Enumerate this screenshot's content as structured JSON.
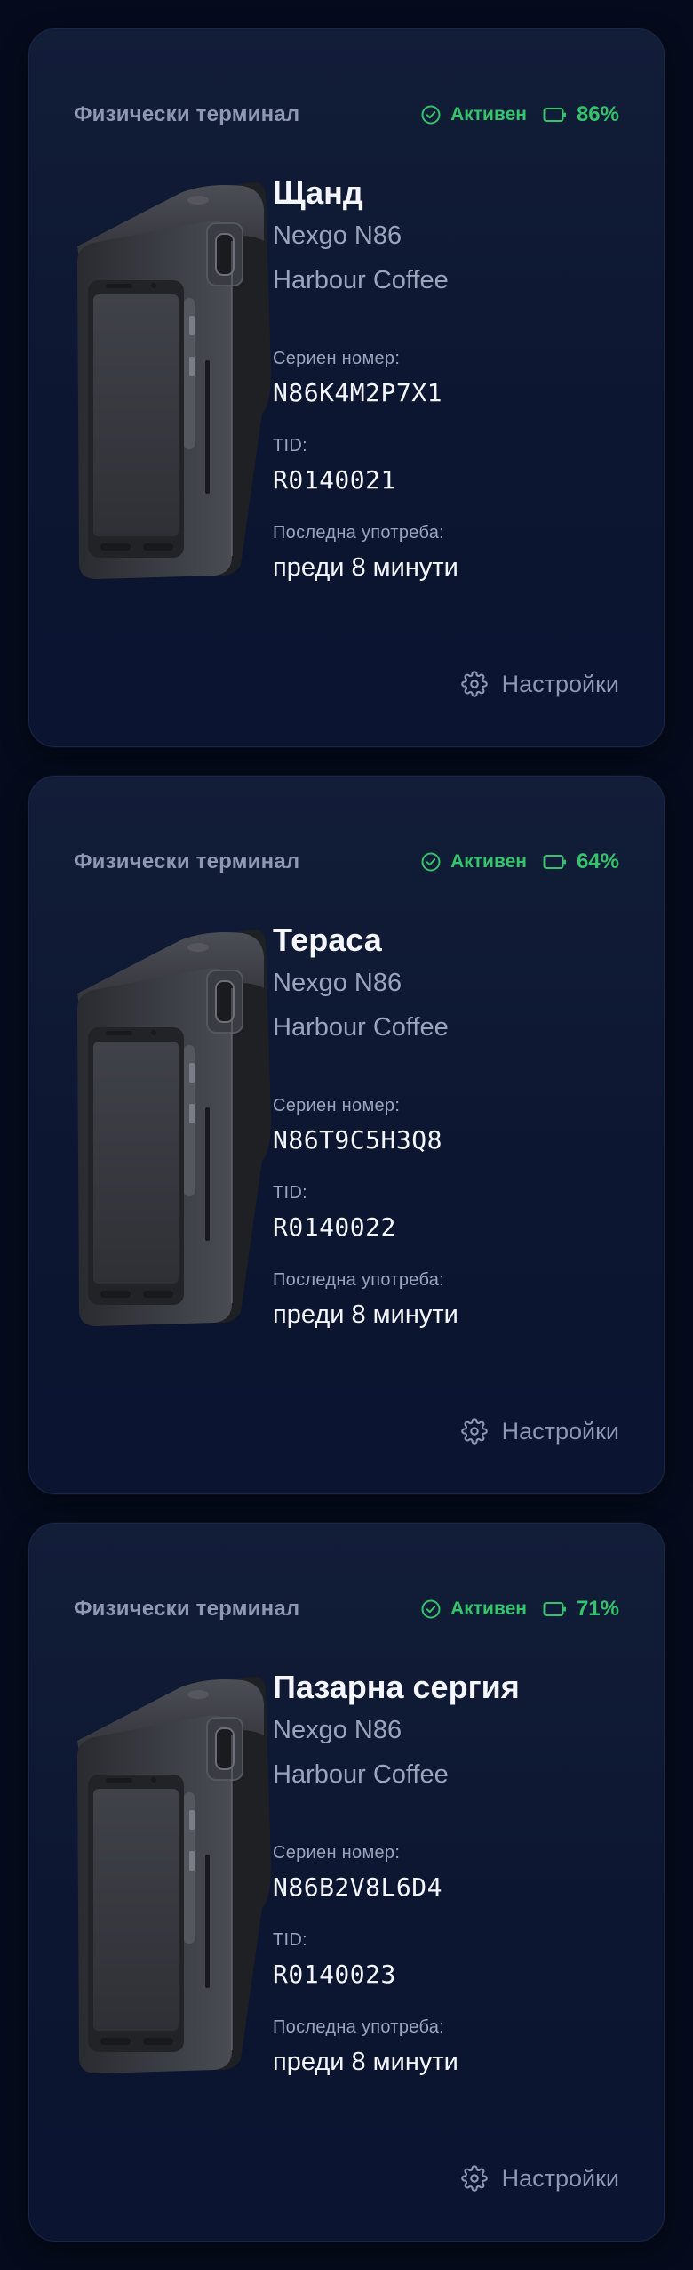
{
  "colors": {
    "background": "#050b1c",
    "card": "#0f1a36",
    "status_green": "#35c46b",
    "muted_text": "#8e98b2",
    "primary_text": "#f4f6fb"
  },
  "labels": {
    "card_type": "Физически терминал",
    "status": "Активен",
    "serial": "Сериен номер:",
    "tid": "TID:",
    "last_used": "Последна употреба:",
    "settings": "Настройки"
  },
  "icons": {
    "status": "check-circle-icon",
    "battery": "battery-icon",
    "settings": "gear-icon",
    "device": "pos-terminal-image"
  },
  "terminals": [
    {
      "name": "Щанд",
      "model": "Nexgo N86",
      "merchant": "Harbour Coffee",
      "serial": "N86K4M2P7X1",
      "tid": "R0140021",
      "last_used": "преди 8 минути",
      "battery": "86%",
      "battery_level": 0.86
    },
    {
      "name": "Тераса",
      "model": "Nexgo N86",
      "merchant": "Harbour Coffee",
      "serial": "N86T9C5H3Q8",
      "tid": "R0140022",
      "last_used": "преди 8 минути",
      "battery": "64%",
      "battery_level": 0.64
    },
    {
      "name": "Пазарна сергия",
      "model": "Nexgo N86",
      "merchant": "Harbour Coffee",
      "serial": "N86B2V8L6D4",
      "tid": "R0140023",
      "last_used": "преди 8 минути",
      "battery": "71%",
      "battery_level": 0.71
    }
  ]
}
